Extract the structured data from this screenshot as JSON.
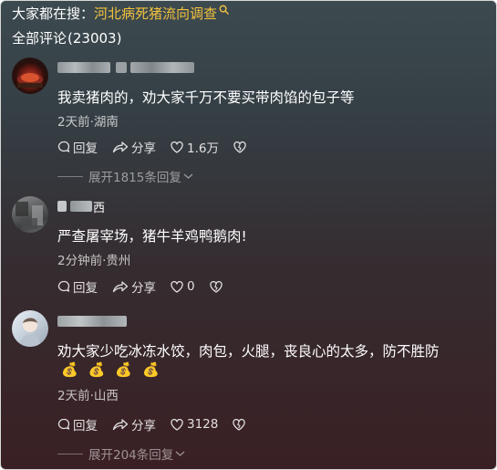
{
  "search": {
    "prefix": "大家都在搜：",
    "topic": "河北病死猪流向调查"
  },
  "comments_header": {
    "label": "全部评论",
    "count": "(23003)"
  },
  "comments": [
    {
      "text": "我卖猪肉的，劝大家千万不要买带肉馅的包子等",
      "meta": "2天前·湖南",
      "reply_label": "回复",
      "share_label": "分享",
      "likes": "1.6万",
      "expand": "展开1815条回复"
    },
    {
      "nick_suffix": "西",
      "text": "严查屠宰场，猪牛羊鸡鸭鹅肉!",
      "meta": "2分钟前·贵州",
      "reply_label": "回复",
      "share_label": "分享",
      "likes": "0"
    },
    {
      "text": "劝大家少吃冰冻水饺，肉包，火腿，丧良心的太多，防不胜防",
      "emojis": [
        "💰",
        "💰",
        "💰",
        "💰"
      ],
      "meta": "2天前·山西",
      "reply_label": "回复",
      "share_label": "分享",
      "likes": "3128",
      "expand": "展开204条回复"
    }
  ],
  "colors": {
    "accent_topic": "#f3c23e",
    "text_primary": "#ffffff",
    "text_secondary": "rgba(255,255,255,0.72)"
  },
  "icons": {
    "search": "search-icon",
    "reply": "reply-icon",
    "share": "share-icon",
    "like": "heart-icon",
    "dislike": "broken-heart-icon",
    "expand": "chevron-down-icon"
  }
}
